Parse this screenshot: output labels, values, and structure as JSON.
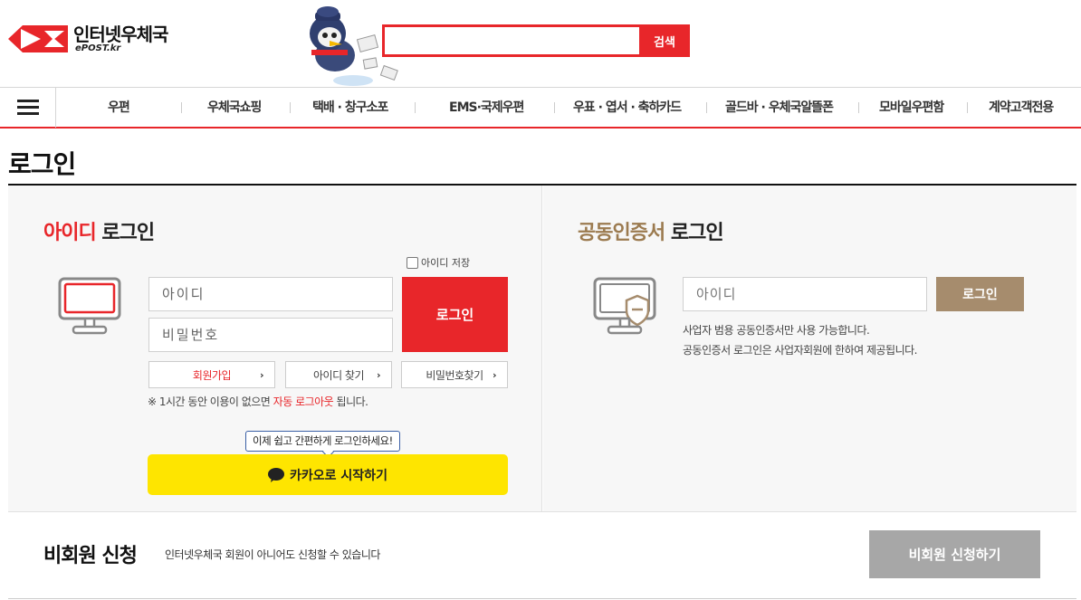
{
  "header": {
    "logo_title": "인터넷우체국",
    "logo_sub": "ePOST.kr",
    "search_placeholder": "",
    "search_button": "검색"
  },
  "nav": {
    "items": [
      "우편",
      "우체국쇼핑",
      "택배 · 창구소포",
      "EMS·국제우편",
      "우표 · 엽서 · 축하카드",
      "골드바 · 우체국알뜰폰",
      "모바일우편함",
      "계약고객전용"
    ]
  },
  "page_title": "로그인",
  "id_login": {
    "heading_highlight": "아이디",
    "heading_rest": " 로그인",
    "remember_label": "아이디 저장",
    "id_placeholder": "아이디",
    "pw_placeholder": "비밀번호",
    "login_button": "로그인",
    "links": [
      "회원가입",
      "아이디 찾기",
      "비밀번호찾기"
    ],
    "notice_prefix": "※ 1시간 동안 이용이 없으면 ",
    "notice_highlight": "자동 로그아웃",
    "notice_suffix": " 됩니다.",
    "tooltip": "이제 쉽고 간편하게 로그인하세요!",
    "kakao_button": "카카오로 시작하기"
  },
  "cert_login": {
    "heading_highlight": "공동인증서",
    "heading_rest": " 로그인",
    "id_placeholder": "아이디",
    "login_button": "로그인",
    "note1": "사업자 범용 공동인증서만 사용 가능합니다.",
    "note2": "공동인증서 로그인은 사업자회원에 한하여 제공됩니다."
  },
  "nonmember": {
    "title": "비회원 신청",
    "desc": "인터넷우체국 회원이 아니어도 신청할 수 있습니다",
    "button": "비회원 신청하기"
  },
  "colors": {
    "brand_red": "#e8262a",
    "cert_brown": "#9c7b50",
    "kakao_yellow": "#fee500"
  }
}
